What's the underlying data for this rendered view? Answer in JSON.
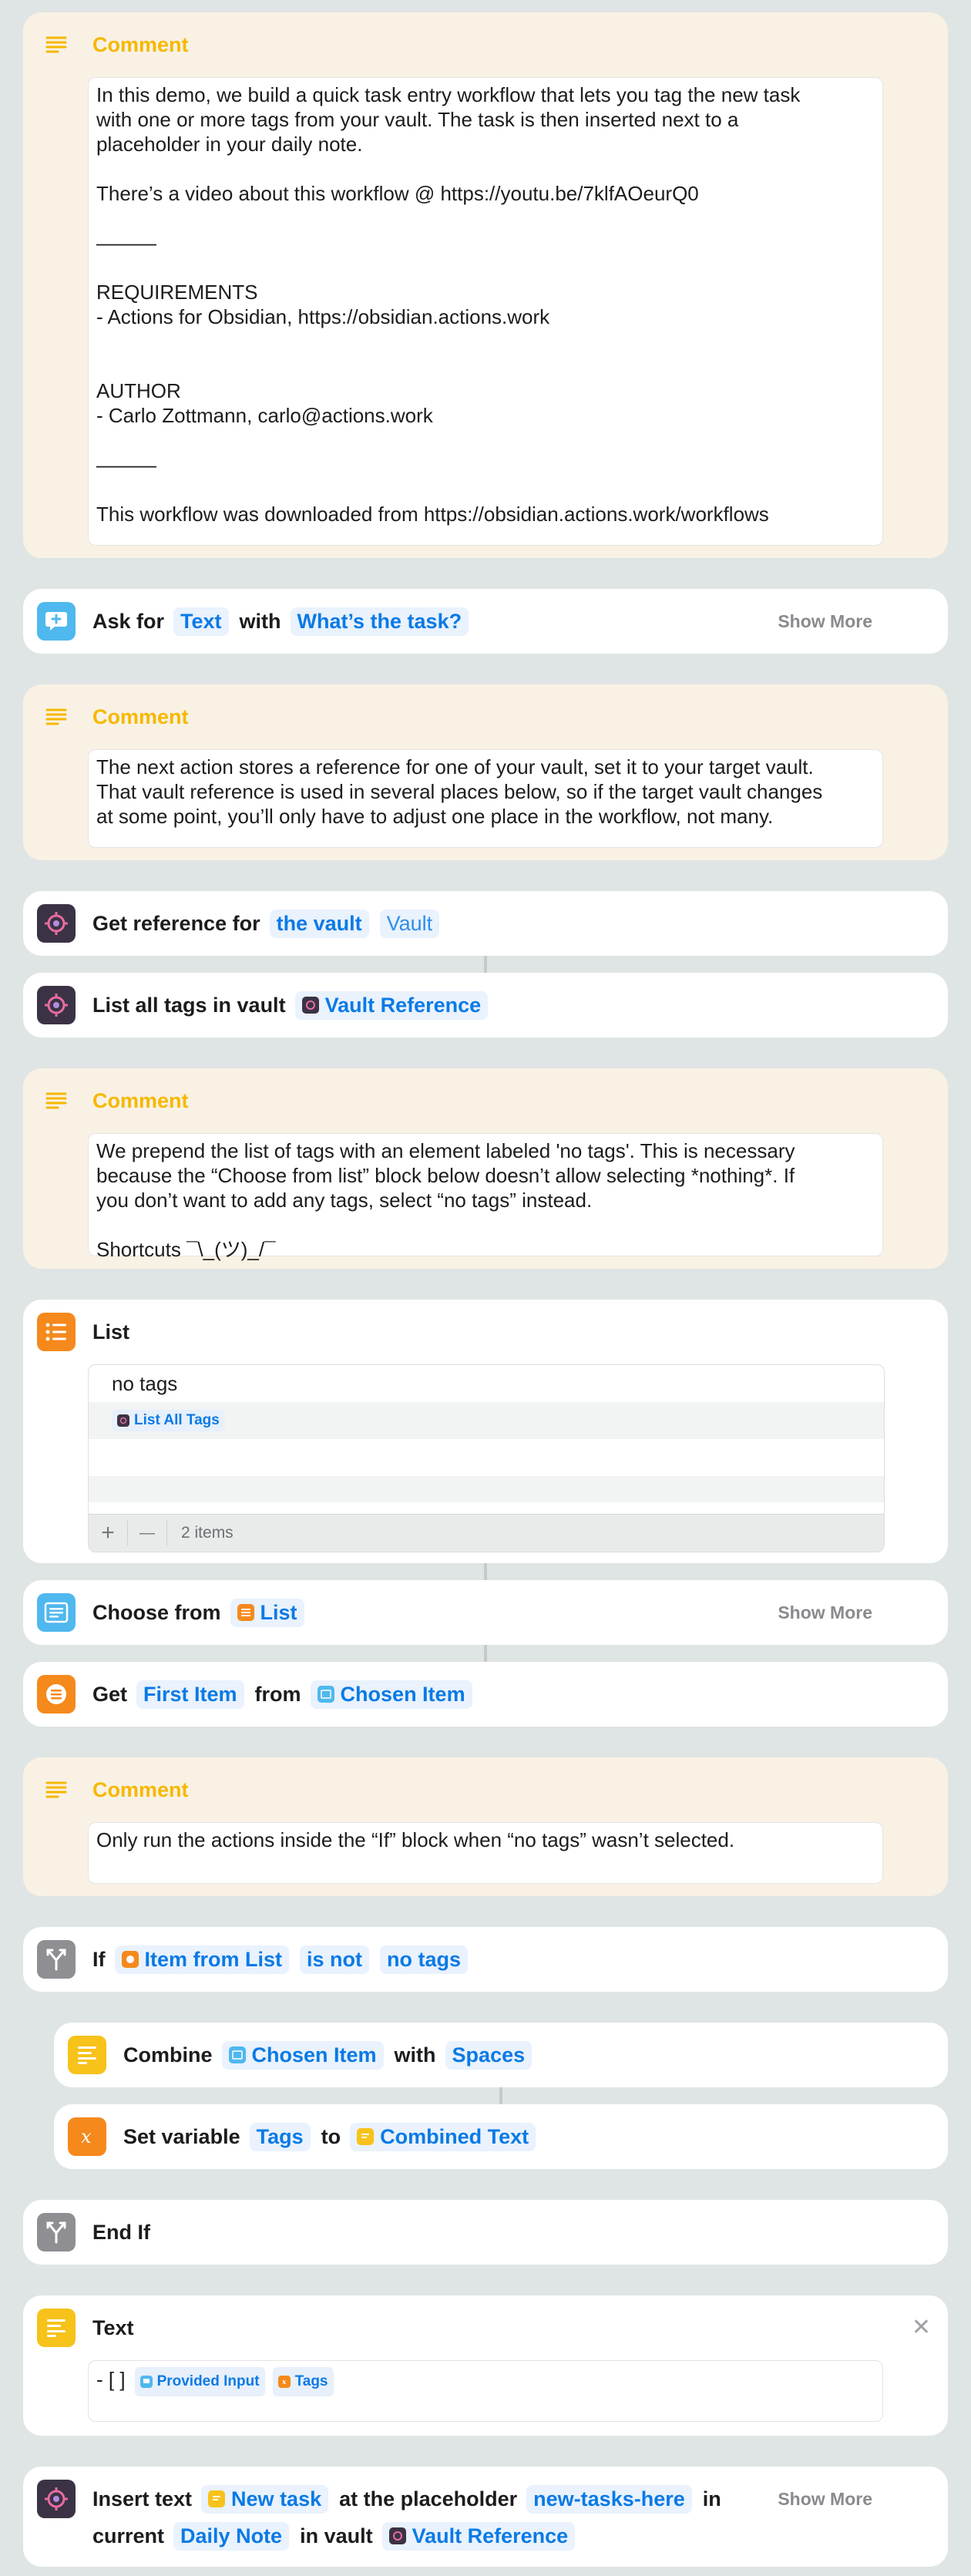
{
  "colors": {
    "background": "#dfe5e4",
    "comment_background": "#f9f1e4",
    "comment_accent": "#f6b800",
    "token_blue": "#0a7ae5"
  },
  "comment1": {
    "title": "Comment",
    "lines": [
      "In this demo, we build a quick task entry workflow that lets you tag the new task",
      "with one or more tags from your vault. The task is then inserted next to a",
      "placeholder in your daily note.",
      "",
      "There’s a video about this workflow @ https://youtu.be/7klfAOeurQ0",
      "",
      "———",
      "",
      "REQUIREMENTS",
      "- Actions for Obsidian, https://obsidian.actions.work",
      "",
      "",
      "AUTHOR",
      "- Carlo Zottmann, carlo@actions.work",
      "",
      "———",
      "",
      "This workflow was downloaded from https://obsidian.actions.work/workflows"
    ]
  },
  "ask": {
    "label_ask": "Ask for",
    "type": "Text",
    "label_with": "with",
    "prompt": "What’s the task?",
    "show_more": "Show More",
    "icon": "ask-input-icon"
  },
  "comment2": {
    "title": "Comment",
    "lines": [
      "The next action stores a reference for one of your vault, set it to your target vault.",
      "That vault reference is used in several places below, so if the target vault changes",
      "at some point, you’ll only have to adjust one place in the workflow, not many."
    ]
  },
  "get_ref": {
    "label": "Get reference for",
    "target": "the vault",
    "vault": "Vault",
    "icon": "obsidian-icon"
  },
  "list_tags": {
    "label": "List all tags in vault",
    "vault_ref": "Vault Reference",
    "icon": "obsidian-icon"
  },
  "comment3": {
    "title": "Comment",
    "lines": [
      "We prepend the list of tags with an element labeled 'no tags'. This is necessary",
      "because the “Choose from list” block below doesn’t allow selecting *nothing*. If",
      "you don’t want to add any tags, select “no tags” instead.",
      "",
      "Shortcuts ¯\\_(ツ)_/¯"
    ]
  },
  "list_block": {
    "title": "List",
    "item1": "no tags",
    "item2_token": "List All Tags",
    "add": "+",
    "remove": "—",
    "count": "2 items",
    "icon": "list-icon"
  },
  "choose": {
    "label": "Choose from",
    "source": "List",
    "show_more": "Show More",
    "icon": "choose-list-icon"
  },
  "get_item": {
    "label_get": "Get",
    "which": "First Item",
    "label_from": "from",
    "source": "Chosen Item",
    "icon": "get-item-icon"
  },
  "comment4": {
    "title": "Comment",
    "lines": [
      "Only run the actions inside the “If” block when “no tags” wasn’t selected."
    ]
  },
  "if_block": {
    "label": "If",
    "input": "Item from List",
    "condition": "is not",
    "value": "no tags",
    "icon": "branch-icon"
  },
  "combine": {
    "label": "Combine",
    "input": "Chosen Item",
    "label_with": "with",
    "separator": "Spaces",
    "icon": "combine-text-icon"
  },
  "set_var": {
    "label": "Set variable",
    "name": "Tags",
    "label_to": "to",
    "value": "Combined Text",
    "icon": "variable-icon"
  },
  "end_if": {
    "label": "End If",
    "icon": "branch-icon"
  },
  "text_block": {
    "title": "Text",
    "prefix": "- [ ]",
    "token1": "Provided Input",
    "token2": "Tags",
    "close": "✕",
    "icon": "text-icon"
  },
  "insert": {
    "label_insert": "Insert text",
    "text_token": "New task",
    "label_placeholder": "at the placeholder",
    "placeholder": "new-tasks-here",
    "label_in": "in",
    "label_current": "current",
    "note": "Daily Note",
    "label_vault": "in vault",
    "vault_ref": "Vault Reference",
    "show_more": "Show More",
    "icon": "obsidian-icon"
  }
}
